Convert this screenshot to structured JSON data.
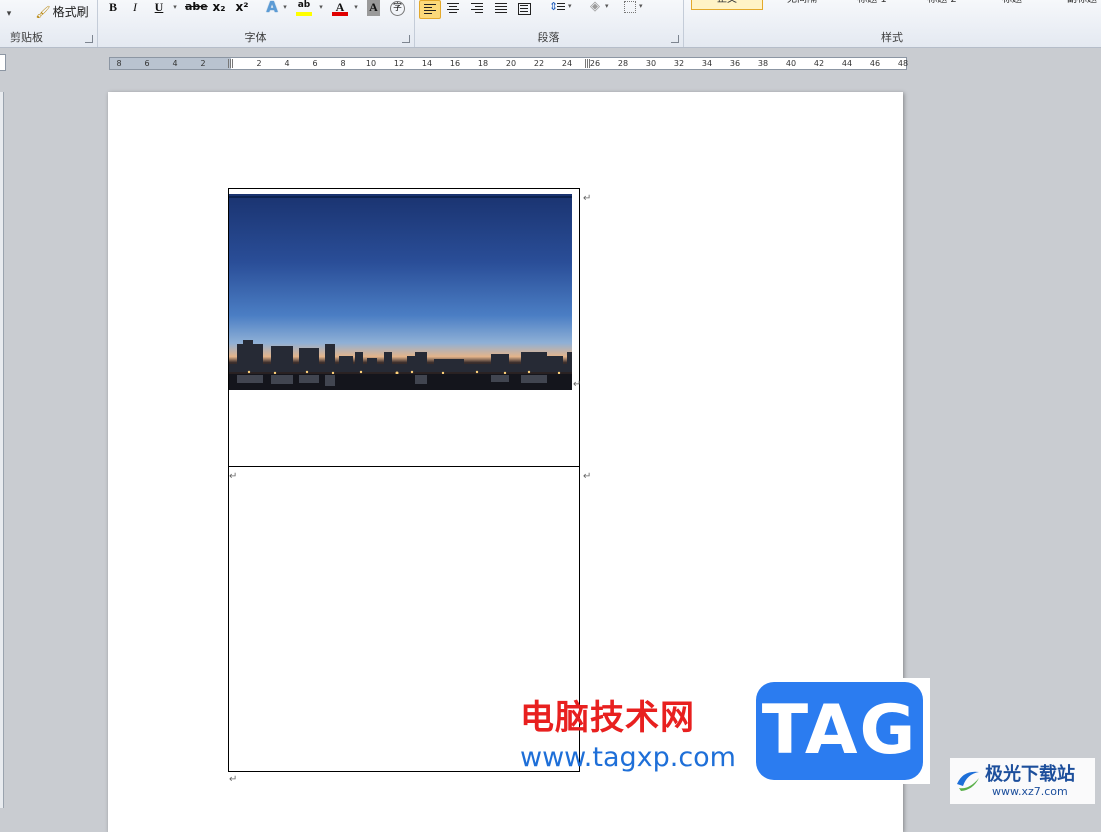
{
  "ribbon": {
    "clipboard": {
      "label": "剪贴板",
      "format_painter": "格式刷",
      "paste_caret": "▾"
    },
    "font": {
      "label": "字体",
      "bold": "B",
      "italic": "I",
      "underline": "U",
      "strike": "abe",
      "subscript": "x₂",
      "superscript": "x²",
      "text_effect": "A",
      "highlight": "ab",
      "font_color": "A",
      "char_shade": "A",
      "enclose": "字"
    },
    "paragraph": {
      "label": "段落"
    },
    "styles": {
      "label": "样式",
      "items": [
        "正文",
        "无间隔",
        "标题 1",
        "标题 2",
        "标题",
        "副标题"
      ]
    }
  },
  "ruler": {
    "ticks": [
      "8",
      "6",
      "4",
      "2",
      "",
      "2",
      "4",
      "6",
      "8",
      "10",
      "12",
      "14",
      "16",
      "18",
      "20",
      "22",
      "24",
      "26",
      "28",
      "30",
      "32",
      "34",
      "36",
      "38",
      "40",
      "42",
      "44",
      "46",
      "48"
    ]
  },
  "document": {
    "paragraph_mark": "↵"
  },
  "watermark": {
    "site_name_cn": "电脑技术网",
    "site_url": "www.tagxp.com",
    "tag": "TAG",
    "jg_name": "极光下载站",
    "jg_url": "www.xz7.com"
  },
  "colors": {
    "highlight": "#ffff00",
    "font_color": "#e00000",
    "active_align": "#fbd97a"
  }
}
